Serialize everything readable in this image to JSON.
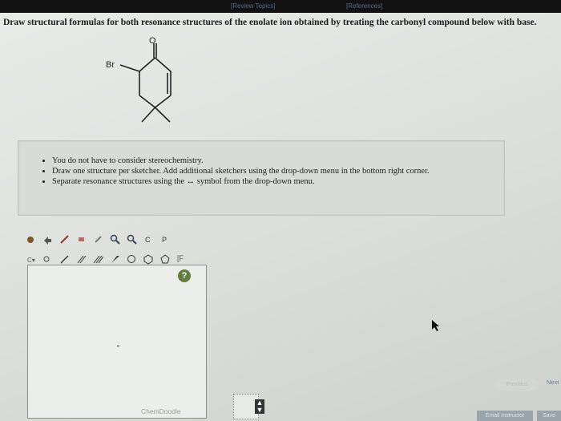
{
  "topbar": {
    "left_link": "[Review Topics]",
    "right_link": "[References]"
  },
  "question": {
    "text": "Draw structural formulas for both resonance structures of the enolate ion obtained by treating the carbonyl compound below with base."
  },
  "molecule": {
    "substituent_label": "Br",
    "carbonyl_label": "O"
  },
  "notes": {
    "items": [
      "You do not have to consider stereochemistry.",
      "Draw one structure per sketcher. Add additional sketchers using the drop-down menu in the bottom right corner.",
      "Separate resonance structures using the ↔ symbol from the drop-down menu."
    ]
  },
  "sketcher": {
    "help_label": "?",
    "brand": "ChemDoodle",
    "bracket_tool": "[F",
    "dropdown_icon": "up-down-arrow-icon"
  },
  "navigation": {
    "previous_label": "Previous",
    "next_label": "Next",
    "email_label": "Email Instructor",
    "save_label": "Save"
  },
  "colors": {
    "help_badge": "#5f7d3d",
    "topbar": "#111111",
    "link": "#5b6b8c"
  }
}
